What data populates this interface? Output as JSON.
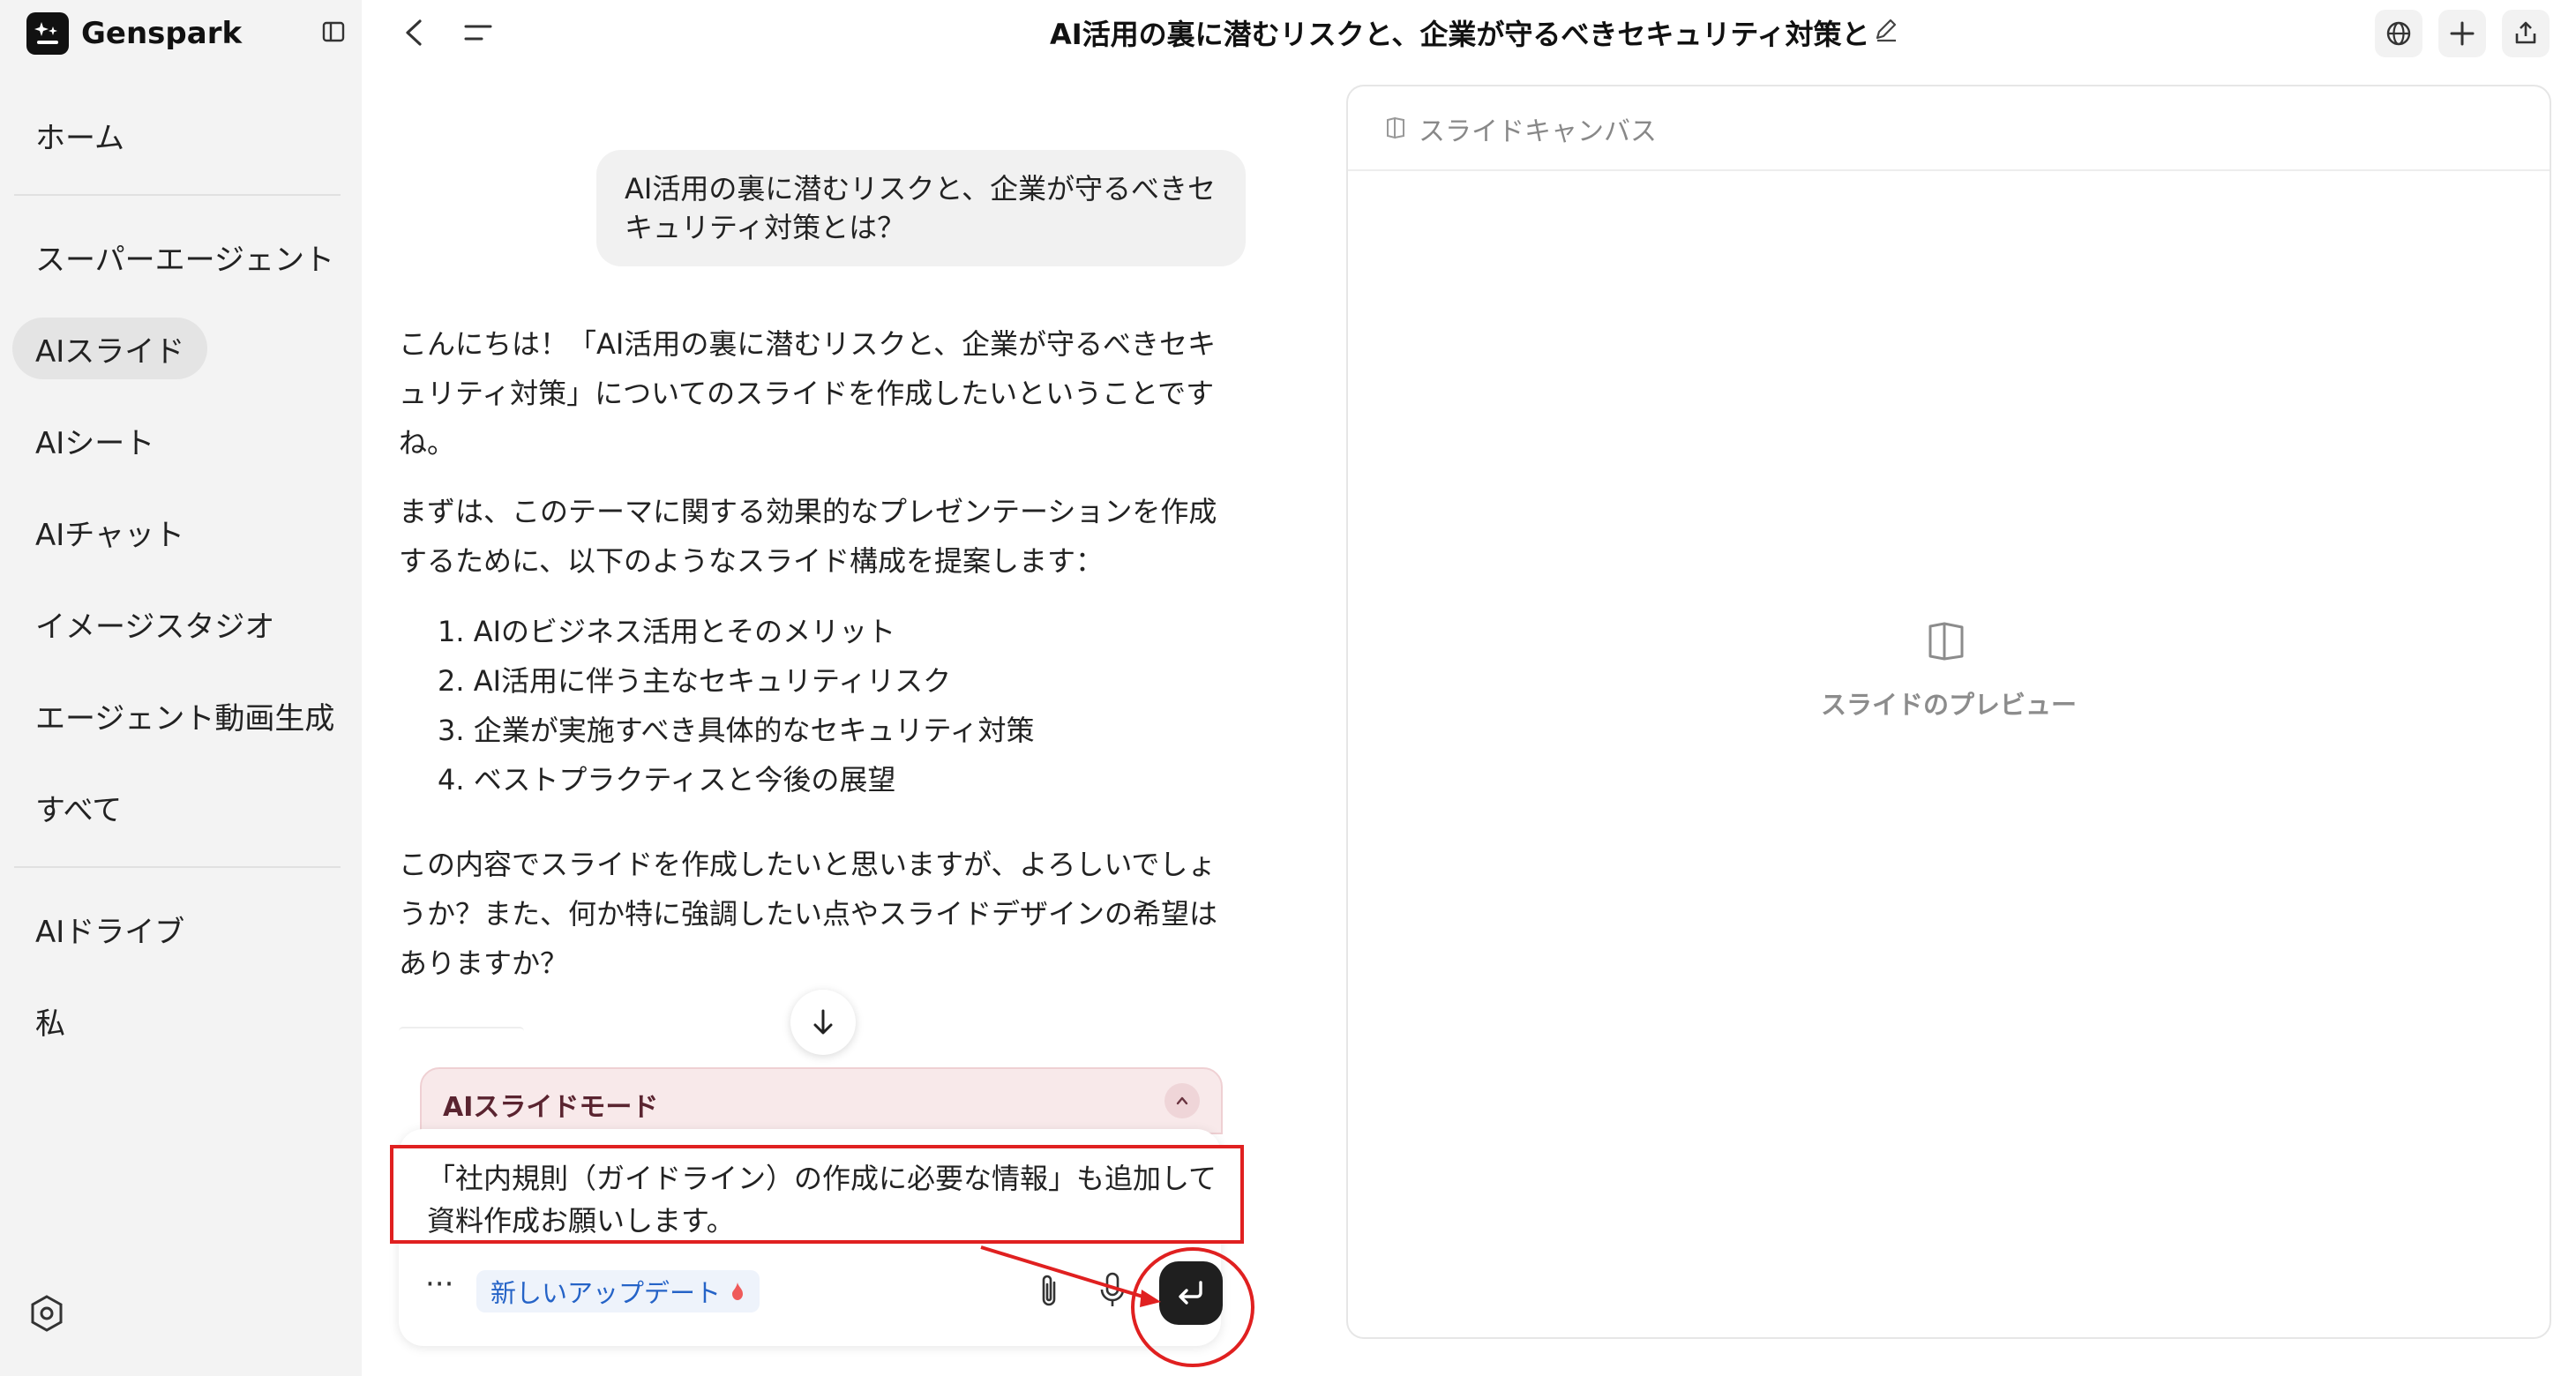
{
  "app": {
    "name": "Genspark"
  },
  "sidebar": {
    "items": [
      {
        "label": "ホーム"
      },
      {
        "label": "スーパーエージェント"
      },
      {
        "label": "AIスライド"
      },
      {
        "label": "AIシート"
      },
      {
        "label": "AIチャット"
      },
      {
        "label": "イメージスタジオ"
      },
      {
        "label": "エージェント動画生成"
      },
      {
        "label": "すべて"
      },
      {
        "label": "AIドライブ"
      },
      {
        "label": "私"
      }
    ],
    "active_item": "AIスライド"
  },
  "header": {
    "title": "AI活用の裏に潜むリスクと、企業が守るべきセキュリティ対策と"
  },
  "chat": {
    "user_message": "AI活用の裏に潜むリスクと、企業が守るべきセキュリティ対策とは？",
    "assistant": {
      "paragraph_1": "こんにちは！「AI活用の裏に潜むリスクと、企業が守るべきセキュリティ対策」についてのスライドを作成したいということですね。",
      "paragraph_2": "まずは、このテーマに関する効果的なプレゼンテーションを作成するために、以下のようなスライド構成を提案します：",
      "steps": [
        "1. AIのビジネス活用とそのメリット",
        "2. AI活用に伴う主なセキュリティリスク",
        "3. 企業が実施すべき具体的なセキュリティ対策",
        "4. ベストプラクティスと今後の展望"
      ],
      "paragraph_3": "この内容でスライドを作成したいと思いますが、よろしいでしょうか？また、何か特に強調したい点やスライドデザインの希望はありますか？"
    }
  },
  "composer": {
    "mode_label": "AIスライドモード",
    "input_value": "「社内規則（ガイドライン）の作成に必要な情報」も追加して資料作成お願いします。",
    "more_label": "···",
    "update_pill": "新しいアップデート"
  },
  "canvas": {
    "header_label": "スライドキャンバス",
    "preview_label": "スライドのプレビュー"
  },
  "colors": {
    "annotation": "#e02020",
    "update_pill_text": "#2563c7",
    "mode_banner_bg": "#f8e9ea"
  },
  "icons": [
    "genspark-logo-icon",
    "sidebar-toggle-icon",
    "back-arrow-icon",
    "menu-icon",
    "edit-pencil-icon",
    "globe-icon",
    "plus-icon",
    "share-icon",
    "arrow-down-icon",
    "chevron-up-icon",
    "paperclip-icon",
    "microphone-icon",
    "enter-icon",
    "flame-icon",
    "book-open-icon",
    "settings-icon"
  ]
}
